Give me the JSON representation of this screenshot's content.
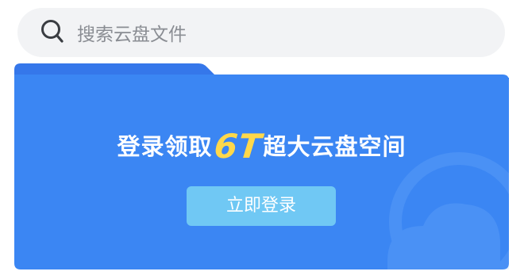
{
  "search": {
    "placeholder": "搜索云盘文件",
    "icon": "search-icon"
  },
  "promo": {
    "title_before": "登录领取",
    "title_highlight": "6T",
    "title_after": "超大云盘空间",
    "button_label": "立即登录",
    "decoration_icon": "cloud-icon"
  },
  "colors": {
    "card_blue": "#3b86f3",
    "card_tab_blue": "#3577ea",
    "highlight_yellow": "#ffd84a",
    "button_light_blue": "#70c8f4",
    "search_bg": "#f2f3f5"
  }
}
